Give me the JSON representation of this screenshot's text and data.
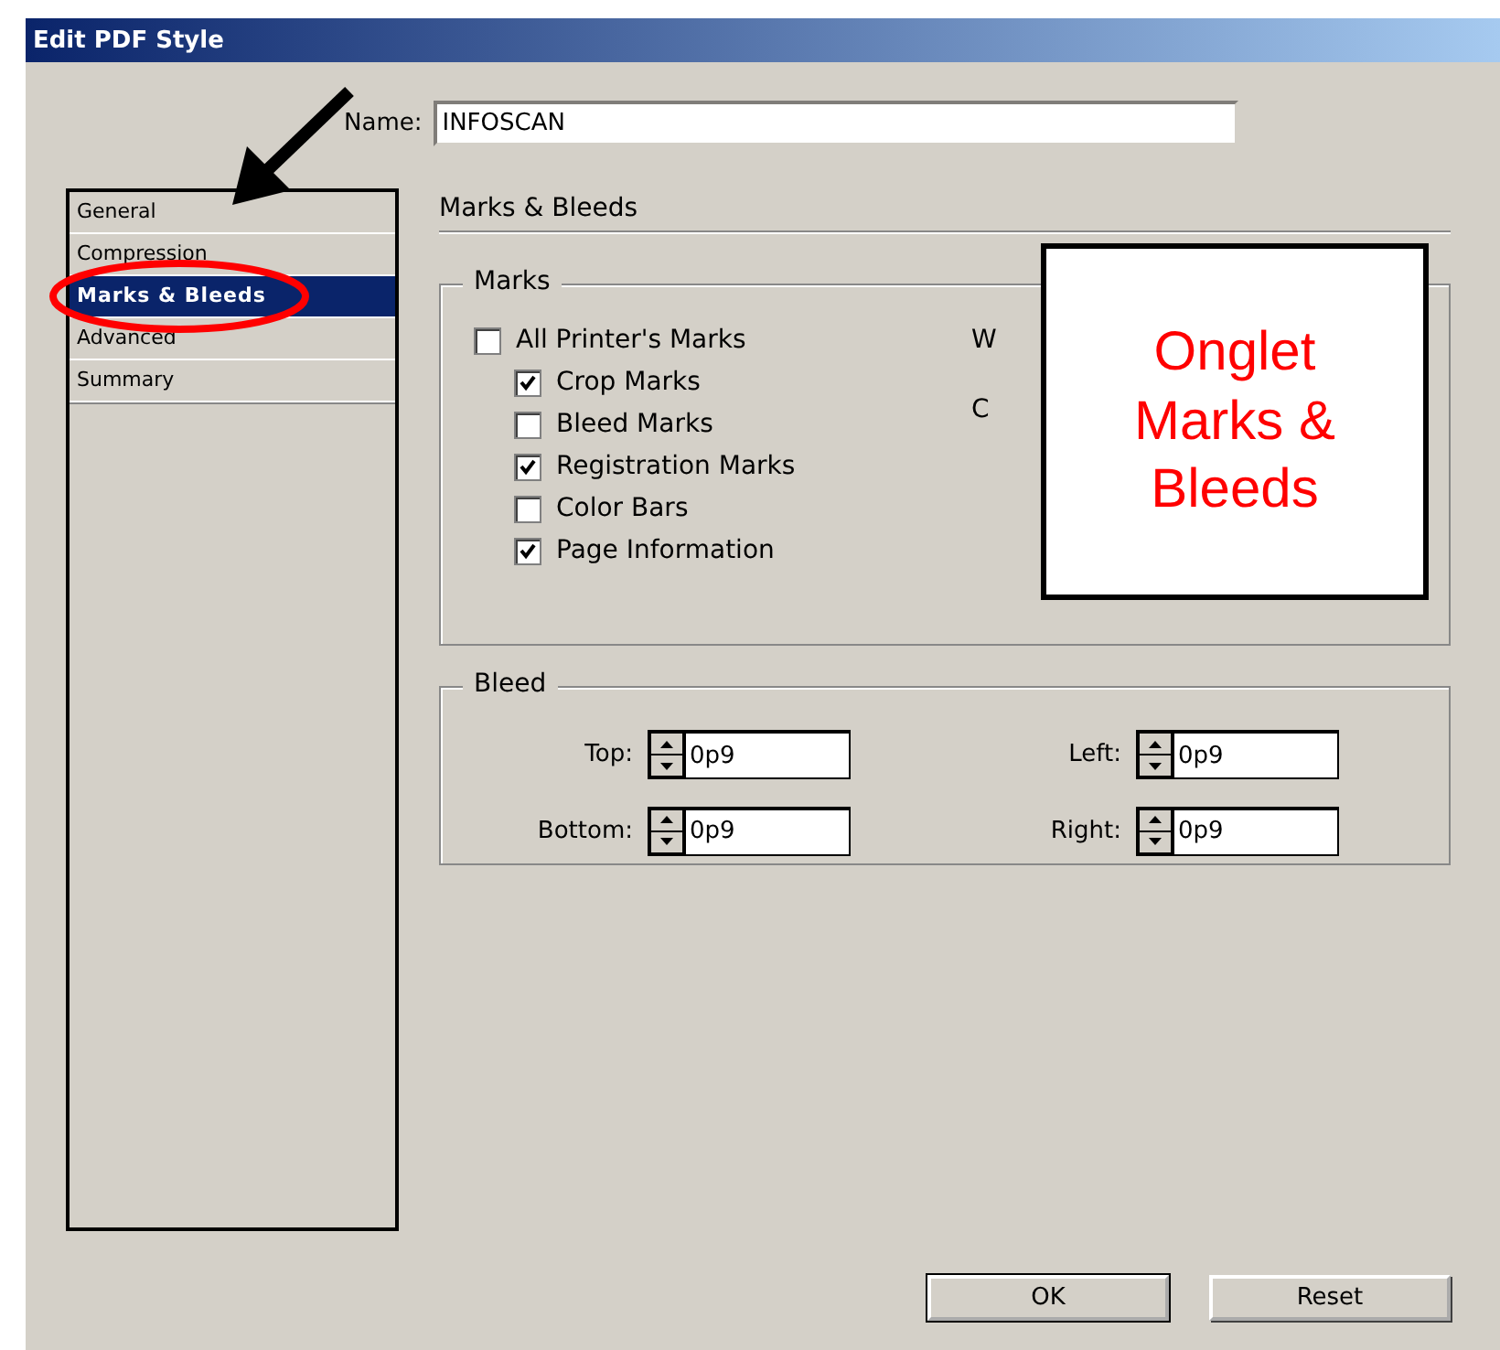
{
  "window": {
    "title": "Edit PDF Style"
  },
  "name_field": {
    "label": "Name:",
    "value": "INFOSCAN"
  },
  "sidebar": {
    "items": [
      {
        "label": "General",
        "selected": false
      },
      {
        "label": "Compression",
        "selected": false
      },
      {
        "label": "Marks & Bleeds",
        "selected": true
      },
      {
        "label": "Advanced",
        "selected": false
      },
      {
        "label": "Summary",
        "selected": false
      }
    ]
  },
  "section_title": "Marks & Bleeds",
  "marks": {
    "title": "Marks",
    "options": [
      {
        "label": "All Printer's Marks",
        "checked": false,
        "children": [
          {
            "label": "Crop Marks",
            "checked": true
          },
          {
            "label": "Bleed Marks",
            "checked": false
          },
          {
            "label": "Registration Marks",
            "checked": true
          },
          {
            "label": "Color Bars",
            "checked": false
          },
          {
            "label": "Page Information",
            "checked": true
          }
        ]
      }
    ],
    "column_2": [
      "W",
      "C"
    ]
  },
  "bleed": {
    "title": "Bleed",
    "fields": [
      {
        "label": "Top:",
        "value": "0p9"
      },
      {
        "label": "Left:",
        "value": "0p9"
      },
      {
        "label": "Bottom:",
        "value": "0p9"
      },
      {
        "label": "Right:",
        "value": "0p9"
      }
    ]
  },
  "buttons": [
    {
      "label": "OK",
      "default": true
    },
    {
      "label": "Reset",
      "default": false
    }
  ],
  "callout": {
    "text": "Onglet Marks & Bleeds"
  }
}
